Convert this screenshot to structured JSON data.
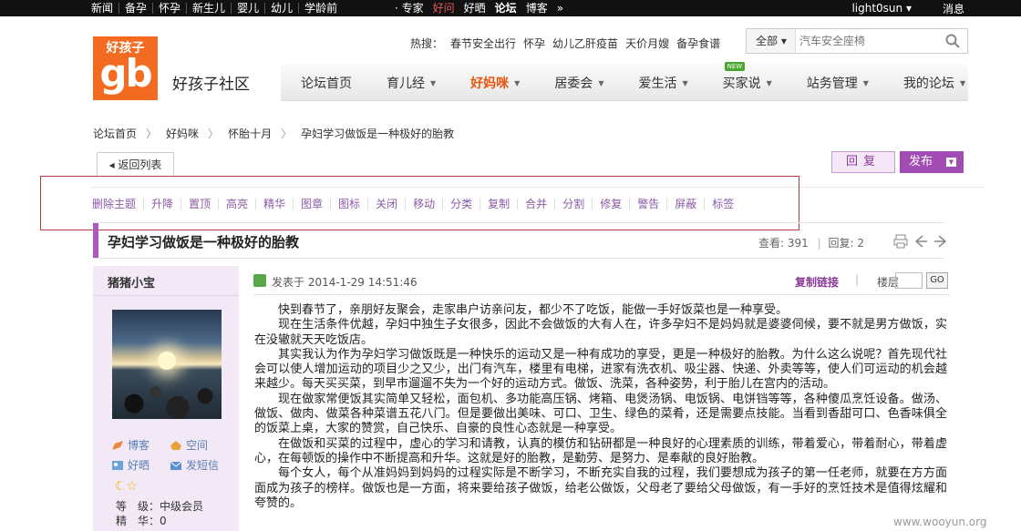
{
  "topbar": {
    "left_links": [
      "新闻",
      "备孕",
      "怀孕",
      "新生儿",
      "婴儿",
      "幼儿",
      "学龄前"
    ],
    "mid_links": [
      "· 专家",
      "好问",
      "好晒",
      "论坛",
      "博客"
    ],
    "more": "»",
    "user": "light0sun ▾",
    "messages": "消息"
  },
  "logo": {
    "top": "好孩子",
    "big": "gb"
  },
  "site_name": "好孩子社区",
  "hot": {
    "label": "热搜：",
    "items": [
      "春节安全出行",
      "怀孕",
      "幼儿乙肝疫苗",
      "天价月嫂",
      "备孕食谱"
    ]
  },
  "search": {
    "scope": "全部 ▾",
    "placeholder": "汽车安全座椅"
  },
  "nav": {
    "items": [
      {
        "label": "论坛首页"
      },
      {
        "label": "育儿经"
      },
      {
        "label": "好妈咪"
      },
      {
        "label": "居委会"
      },
      {
        "label": "爱生活"
      },
      {
        "label": "买家说",
        "badge": "NEW"
      },
      {
        "label": "站务管理"
      },
      {
        "label": "我的论坛"
      }
    ]
  },
  "breadcrumb": [
    "论坛首页",
    "好妈咪",
    "怀胎十月",
    "孕妇学习做饭是一种极好的胎教"
  ],
  "breadcrumb_sep": "〉",
  "buttons": {
    "back": "◂ 返回列表",
    "reply": "回复",
    "post": "发布"
  },
  "admin_actions": [
    "删除主题",
    "升降",
    "置顶",
    "高亮",
    "精华",
    "图章",
    "图标",
    "关闭",
    "移动",
    "分类",
    "复制",
    "合并",
    "分割",
    "修复",
    "警告",
    "屏蔽",
    "标签"
  ],
  "thread": {
    "title": "孕妇学习做饭是一种极好的胎教",
    "views_label": "查看:",
    "views": "391",
    "replies_label": "回复:",
    "replies": "2"
  },
  "author": {
    "name": "猪猪小宝",
    "links": [
      "博客",
      "空间",
      "好晒",
      "发短信"
    ],
    "stars": "☾☆",
    "level_label": "等　级：",
    "level": "中级会员",
    "essence_label": "精　华：",
    "essence": "0"
  },
  "post": {
    "date": "发表于 2014-1-29 14:51:46",
    "copy_link": "复制链接",
    "floor_label": "楼层",
    "go": "GO",
    "paragraphs": [
      "快到春节了，亲朋好友聚会，走家串户访亲问友，都少不了吃饭，能做一手好饭菜也是一种享受。",
      "现在生活条件优越，孕妇中独生子女很多，因此不会做饭的大有人在，许多孕妇不是妈妈就是婆婆伺候，要不就是男方做饭，实在没辙就天天吃饭店。",
      "其实我认为作为孕妇学习做饭既是一种快乐的运动又是一种有成功的享受，更是一种极好的胎教。为什么这么说呢？首先现代社会可以使人增加运动的项目少之又少，出门有汽车，楼里有电梯，进家有洗衣机、吸尘器、快递、外卖等等，使人们可运动的机会越来越少。每天买买菜，到早市遛遛不失为一个好的运动方式。做饭、洗菜，各种姿势，利于胎儿在宫内的活动。",
      "现在做家常便饭其实简单又轻松，面包机、多功能高压锅、烤箱、电煲汤锅、电饭锅、电饼铛等等，各种傻瓜烹饪设备。做汤、做饭、做肉、做菜各种菜谱五花八门。但是要做出美味、可口、卫生、绿色的菜肴，还是需要点技能。当看到香甜可口、色香味俱全的饭菜上桌，大家的赞赏，自己快乐、自豪的良性心态就是一种享受。",
      "在做饭和买菜的过程中，虚心的学习和请教，认真的模仿和钻研都是一种良好的心理素质的训练，带着爱心，带着耐心，带着虚心，在每顿饭的操作中不断提高和升华。这就是好的胎教，是勤劳、是努力、是奉献的良好胎教。",
      "每个女人，每个从准妈妈到妈妈的过程实际是不断学习，不断充实自我的过程，我们要想成为孩子的第一任老师，就要在方方面面成为孩子的榜样。做饭也是一方面，将来要给孩子做饭，给老公做饭，父母老了要给父母做饭，有一手好的烹饪技术是值得炫耀和夸赞的。"
    ]
  },
  "watermark": "www.wooyun.org",
  "colors": {
    "brand_orange": "#f26b21",
    "accent_purple": "#a24bb3",
    "admin_link": "#8a5aa6",
    "annotation_red": "#b23b3b"
  }
}
